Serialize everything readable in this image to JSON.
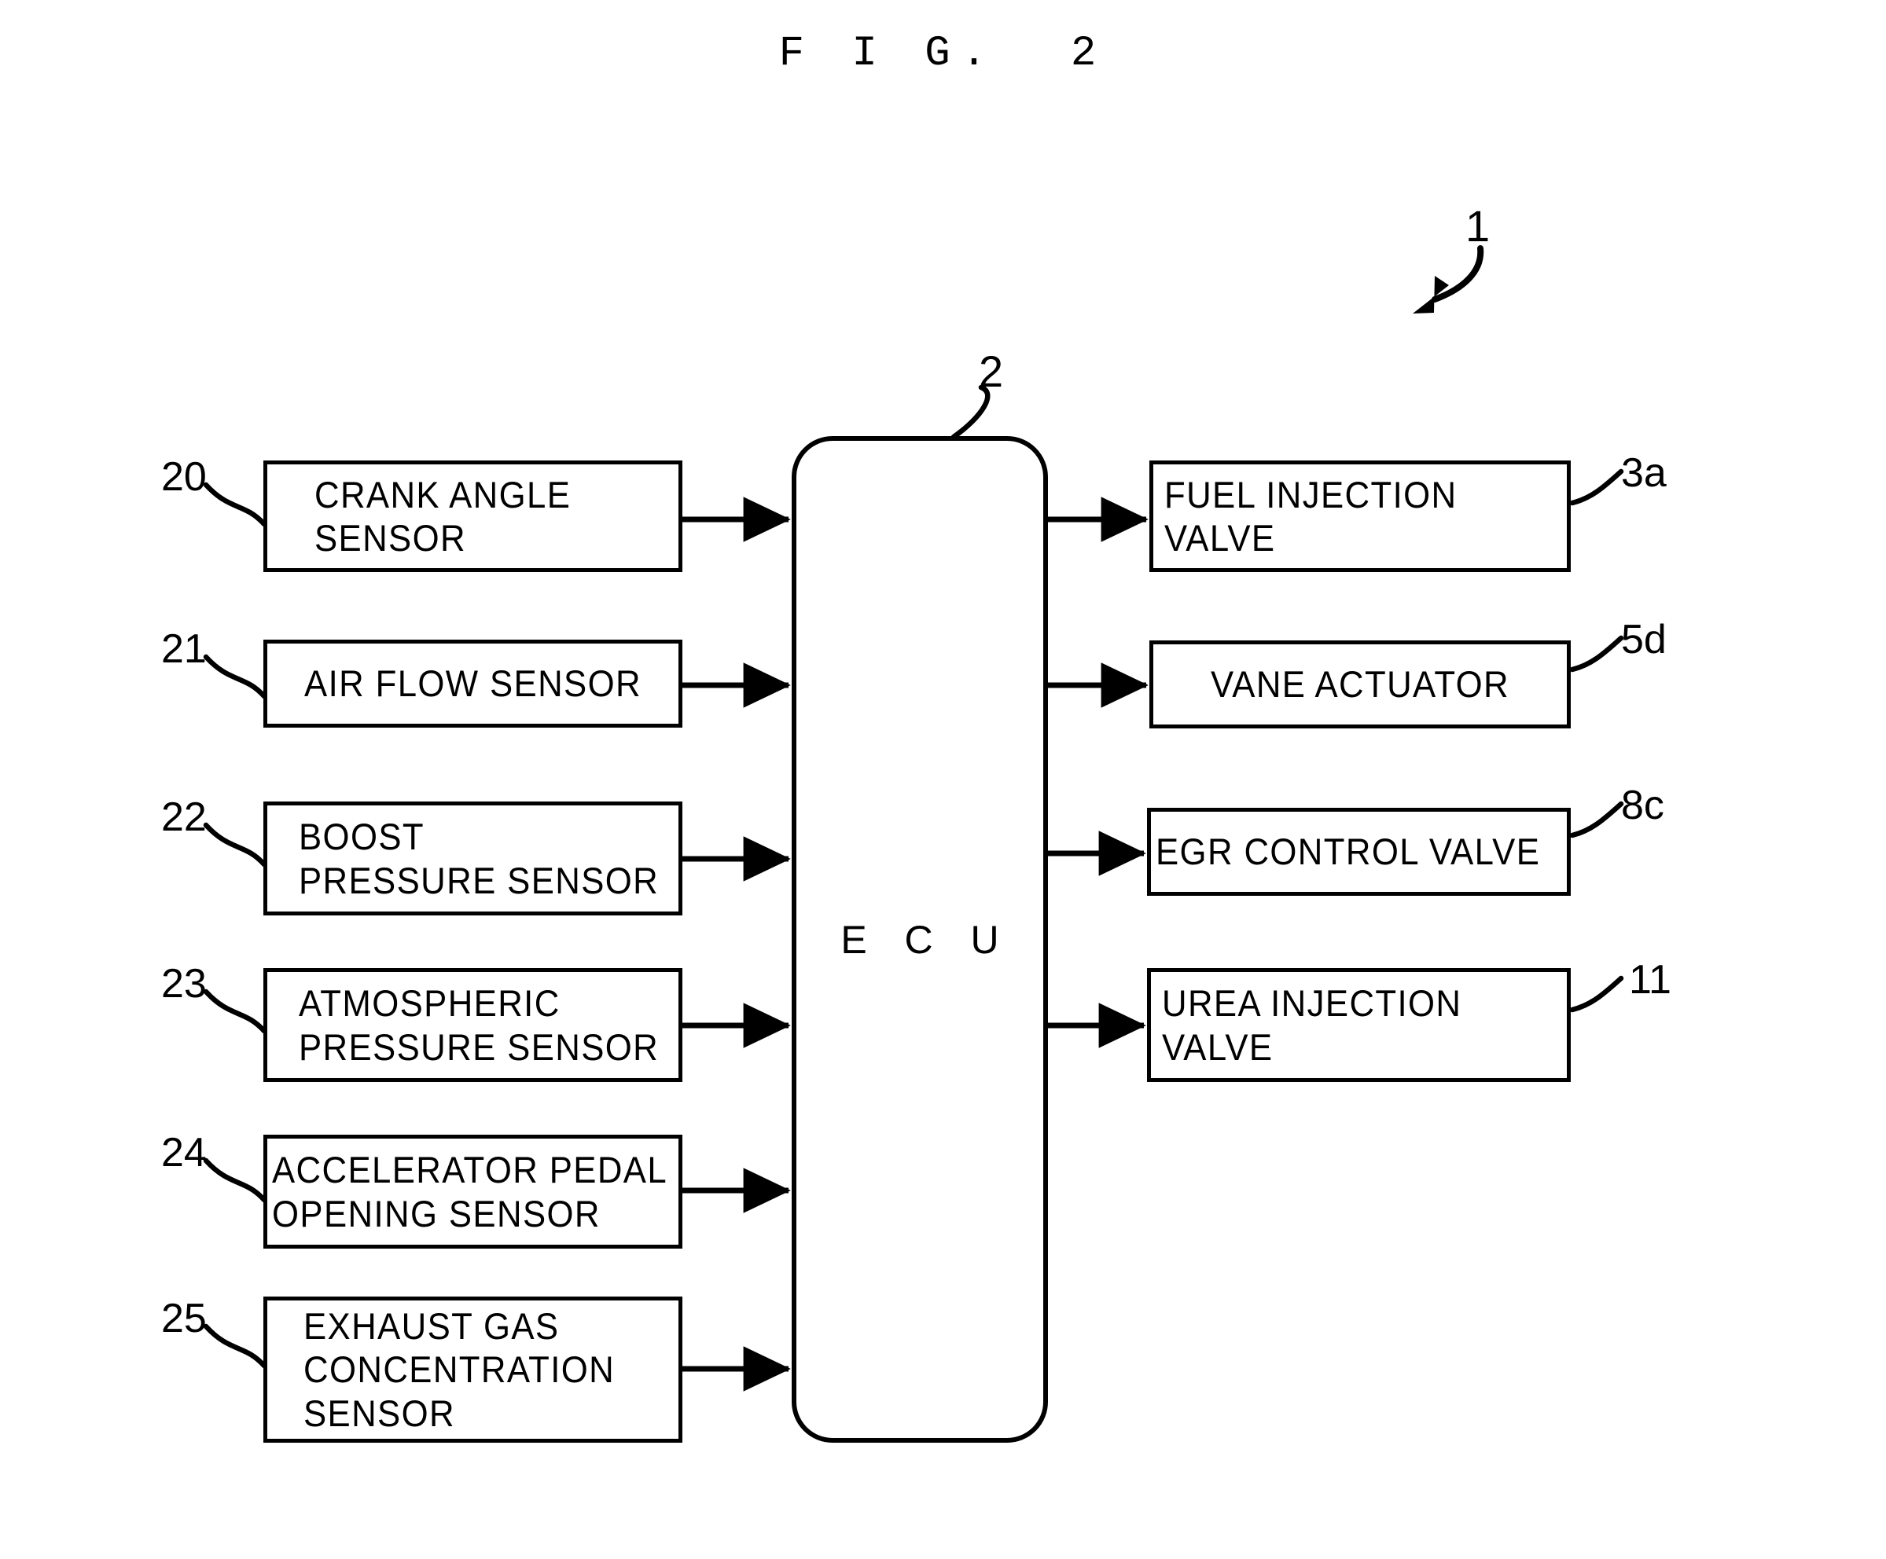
{
  "figure": {
    "title": "F I G.  2",
    "system_ref": "1",
    "controller_ref": "2",
    "controller_label": "E C U"
  },
  "inputs": [
    {
      "ref": "20",
      "lines": [
        "CRANK ANGLE",
        "SENSOR"
      ]
    },
    {
      "ref": "21",
      "lines": [
        "AIR FLOW SENSOR"
      ]
    },
    {
      "ref": "22",
      "lines": [
        "BOOST",
        "PRESSURE SENSOR"
      ]
    },
    {
      "ref": "23",
      "lines": [
        "ATMOSPHERIC",
        "PRESSURE SENSOR"
      ]
    },
    {
      "ref": "24",
      "lines": [
        "ACCELERATOR PEDAL",
        "OPENING SENSOR"
      ]
    },
    {
      "ref": "25",
      "lines": [
        "EXHAUST GAS",
        "CONCENTRATION",
        "SENSOR"
      ]
    }
  ],
  "outputs": [
    {
      "ref": "3a",
      "lines": [
        "FUEL INJECTION",
        "VALVE"
      ]
    },
    {
      "ref": "5d",
      "lines": [
        "VANE ACTUATOR"
      ]
    },
    {
      "ref": "8c",
      "lines": [
        "EGR CONTROL VALVE"
      ]
    },
    {
      "ref": "11",
      "lines": [
        "UREA INJECTION",
        "VALVE"
      ]
    }
  ],
  "colors": {
    "ink": "#000000",
    "paper": "#ffffff"
  }
}
